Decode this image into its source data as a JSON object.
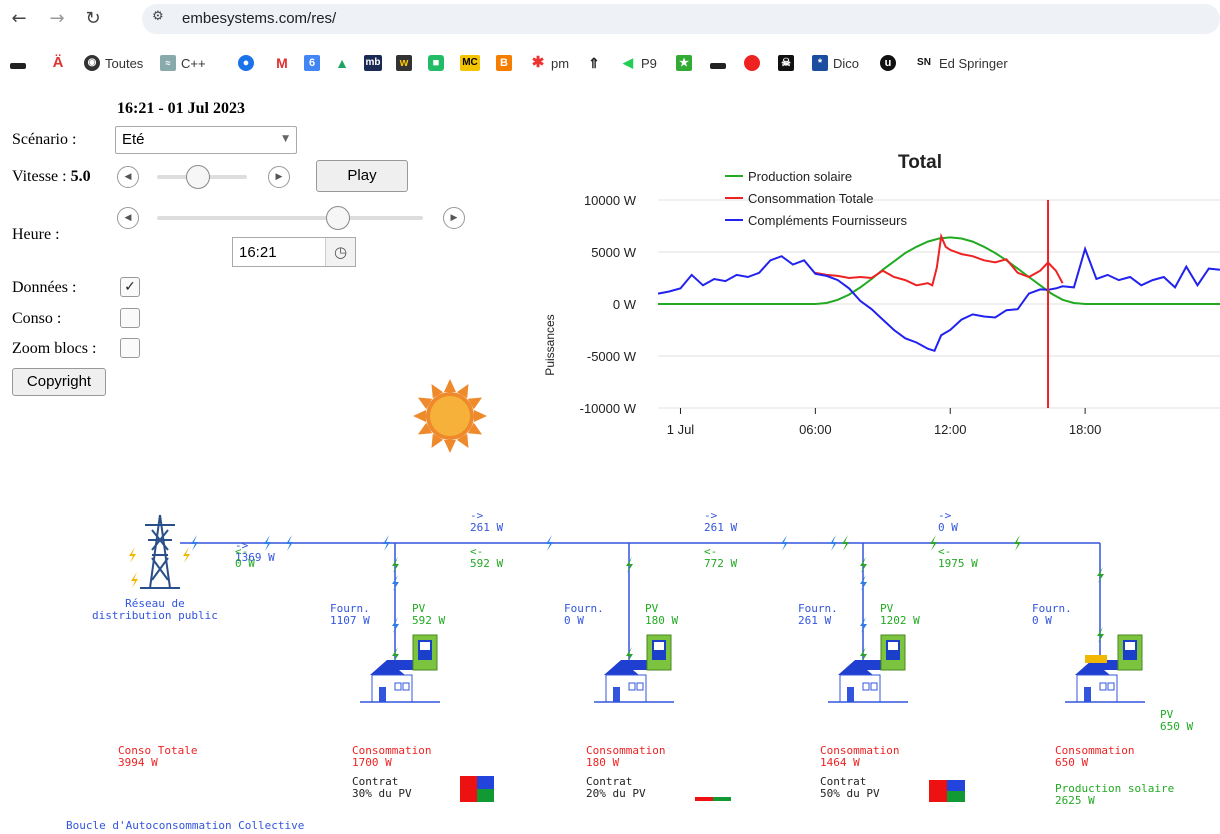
{
  "browser": {
    "url": "embesystems.com/res/",
    "bookmarks": [
      "Toutes",
      "C++",
      "mb",
      "MC",
      "pm",
      "P9",
      "Dico",
      "Ed Springer"
    ]
  },
  "controls": {
    "datetime": "16:21 - 01 Jul 2023",
    "scenario_label": "Scénario :",
    "scenario_value": "Eté",
    "vitesse_label": "Vitesse :",
    "vitesse_value": "5.0",
    "play_label": "Play",
    "heure_label": "Heure :",
    "heure_value": "16:21",
    "donnees_label": "Données :",
    "donnees_checked": true,
    "conso_label": "Conso :",
    "conso_checked": false,
    "zoom_label": "Zoom blocs :",
    "zoom_checked": false,
    "copyright_label": "Copyright",
    "heure_slider_fraction": 0.68,
    "vitesse_slider_fraction": 0.45
  },
  "chart_data": {
    "type": "line",
    "title": "Total",
    "ylabel": "Puissances",
    "yticks": [
      "10000 W",
      "5000 W",
      "0 W",
      "-5000 W",
      "-10000 W"
    ],
    "yvalues": [
      10000,
      5000,
      0,
      -5000,
      -10000
    ],
    "ylim": [
      -10000,
      10000
    ],
    "xticks": [
      "1 Jul",
      "06:00",
      "12:00",
      "18:00"
    ],
    "xtick_hours": [
      0,
      6,
      12,
      18
    ],
    "xlim": [
      -1,
      24
    ],
    "legend_position": "top-left",
    "current_hour": 16.35,
    "colors": {
      "production": "#22aa22",
      "consommation": "#ee2222",
      "complements": "#2222ee",
      "cursor": "#ee2222"
    },
    "series": [
      {
        "name": "Production solaire",
        "x": [
          -1,
          6,
          6.5,
          7,
          7.5,
          8,
          8.5,
          9,
          9.5,
          10,
          10.5,
          11,
          11.5,
          12,
          12.5,
          13,
          13.5,
          14,
          14.5,
          15,
          15.5,
          16,
          16.5,
          17,
          17.5,
          18,
          24
        ],
        "y": [
          0,
          0,
          100,
          400,
          900,
          1600,
          2400,
          3300,
          4100,
          4900,
          5500,
          6000,
          6300,
          6400,
          6300,
          6000,
          5500,
          4900,
          4200,
          3400,
          2600,
          1800,
          1000,
          400,
          100,
          0,
          0
        ]
      },
      {
        "name": "Consommation Totale",
        "x": [
          6,
          6.5,
          7,
          7.5,
          8,
          8.5,
          9,
          9.5,
          10,
          10.5,
          11,
          11.2,
          11.4,
          11.6,
          11.8,
          12,
          12.5,
          13,
          13.5,
          14,
          14.5,
          15,
          15.5,
          16,
          16.35,
          16.7,
          17
        ],
        "y": [
          3000,
          2800,
          2700,
          2500,
          2600,
          2500,
          3200,
          2600,
          2300,
          1800,
          2000,
          1800,
          3500,
          6500,
          5500,
          5200,
          4800,
          4600,
          4200,
          4000,
          4300,
          3000,
          2600,
          3200,
          3994,
          3200,
          2000
        ]
      },
      {
        "name": "Compléments Fournisseurs",
        "x": [
          -1,
          -0.5,
          0,
          0.5,
          1,
          1.5,
          2,
          2.5,
          3,
          3.5,
          4,
          4.5,
          5,
          5.5,
          6,
          6.5,
          7,
          7.5,
          8,
          8.5,
          9,
          9.5,
          10,
          10.5,
          11,
          11.3,
          11.6,
          12,
          12.5,
          13,
          13.5,
          14,
          14.5,
          15,
          15.5,
          16,
          16.35,
          16.7,
          17,
          17.5,
          18,
          18.5,
          19,
          19.5,
          20,
          20.5,
          21,
          21.5,
          22,
          22.5,
          23,
          23.5,
          24
        ],
        "y": [
          1000,
          1200,
          1500,
          2800,
          1800,
          2400,
          2200,
          2800,
          2600,
          3000,
          4200,
          4600,
          3800,
          4200,
          2900,
          2700,
          2300,
          1500,
          300,
          -500,
          -1500,
          -2500,
          -3300,
          -3700,
          -4300,
          -4500,
          -3000,
          -2500,
          -1500,
          -1000,
          -1200,
          -1300,
          -600,
          -500,
          1000,
          1400,
          1369,
          1500,
          1700,
          1600,
          5300,
          2400,
          2800,
          2300,
          2600,
          1800,
          2300,
          2600,
          1600,
          3600,
          1800,
          3400,
          3300
        ]
      }
    ]
  },
  "network": {
    "grid_label": "Réseau de\ndistribution public",
    "segments": [
      {
        "fwd": "->\n1369 W",
        "back": "<-\n0 W"
      },
      {
        "fwd": "->\n261 W",
        "back": "<-\n592 W"
      },
      {
        "fwd": "->\n261 W",
        "back": "<-\n772 W"
      },
      {
        "fwd": "->\n0 W",
        "back": "<-\n1975 W"
      }
    ],
    "houses": [
      {
        "fourn": "Fourn.\n1107 W",
        "pv": "PV\n592 W",
        "conso": "Consommation\n1700 W",
        "contrat": "Contrat\n30% du PV"
      },
      {
        "fourn": "Fourn.\n0 W",
        "pv": "PV\n180 W",
        "conso": "Consommation\n180 W",
        "contrat": "Contrat\n20% du PV"
      },
      {
        "fourn": "Fourn.\n261 W",
        "pv": "PV\n1202 W",
        "conso": "Consommation\n1464 W",
        "contrat": "Contrat\n50% du PV"
      },
      {
        "fourn": "Fourn.\n0 W",
        "pv": "PV\n650 W",
        "conso": "Consommation\n650 W",
        "contrat": ""
      }
    ],
    "conso_totale": "Conso Totale\n3994 W",
    "production_solaire": "Production solaire\n2625 W",
    "boucle_label": "Boucle d'Autoconsommation Collective"
  }
}
